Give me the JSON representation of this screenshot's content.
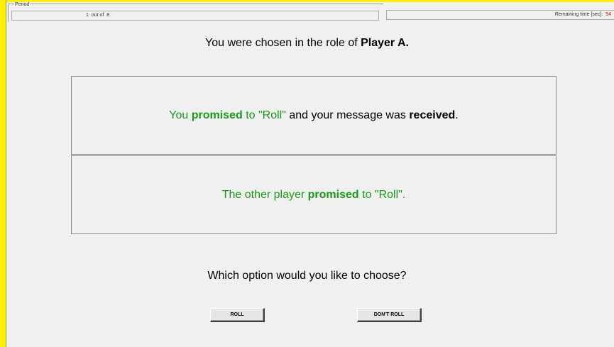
{
  "header": {
    "period_label": "Period",
    "period_current": "1",
    "period_sep": "out of",
    "period_total": "8",
    "time_label": "Remaining time [sec]:",
    "time_value": "54"
  },
  "role": {
    "prefix": "You were chosen in the role of ",
    "role_name": "Player A."
  },
  "box1": {
    "t1": "You ",
    "t2": "promised",
    "t3": " to \"Roll\"",
    "t4": " and your message was ",
    "t5": "received",
    "t6": "."
  },
  "box2": {
    "t1": "The other player ",
    "t2": "promised",
    "t3": " to \"Roll\"."
  },
  "question": "Which option would you like to choose?",
  "buttons": {
    "roll": "ROLL",
    "dont_roll": "DON'T ROLL"
  },
  "colors": {
    "frame": "#ffef00",
    "promise_green": "#1a9a1a",
    "time_red": "#e00000"
  }
}
